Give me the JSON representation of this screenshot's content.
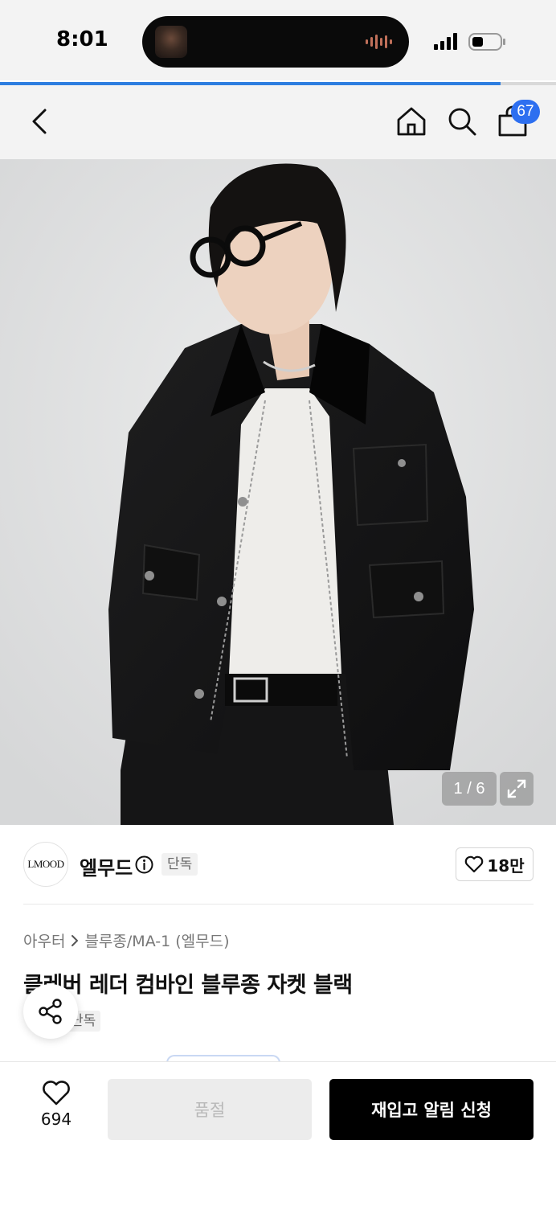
{
  "status_bar": {
    "time": "8:01",
    "page_load_progress": 0.9
  },
  "nav": {
    "back_icon": "chevron-left-icon",
    "home_icon": "home-icon",
    "search_icon": "search-icon",
    "cart_icon": "shopping-bag-icon",
    "cart_count": "67"
  },
  "gallery": {
    "counter": "1 / 6",
    "expand_icon": "expand-icon"
  },
  "brand": {
    "logo_text": "LMOOD",
    "name": "엘무드",
    "exclusive_tag": "단독",
    "likes": "18만"
  },
  "product": {
    "breadcrumb_parent": "아우터",
    "breadcrumb_child": "블루종/MA-1 (엘무드)",
    "title": "클레버 레더 컴바인 블루종 자켓 블랙",
    "tag": "단독"
  },
  "bottom_bar": {
    "wish_count": "694",
    "soldout_label": "품절",
    "restock_label": "재입고 알림 신청"
  },
  "colors": {
    "accent_blue": "#2d6ff0",
    "primary_button": "#000000",
    "disabled_button": "#ececec"
  }
}
